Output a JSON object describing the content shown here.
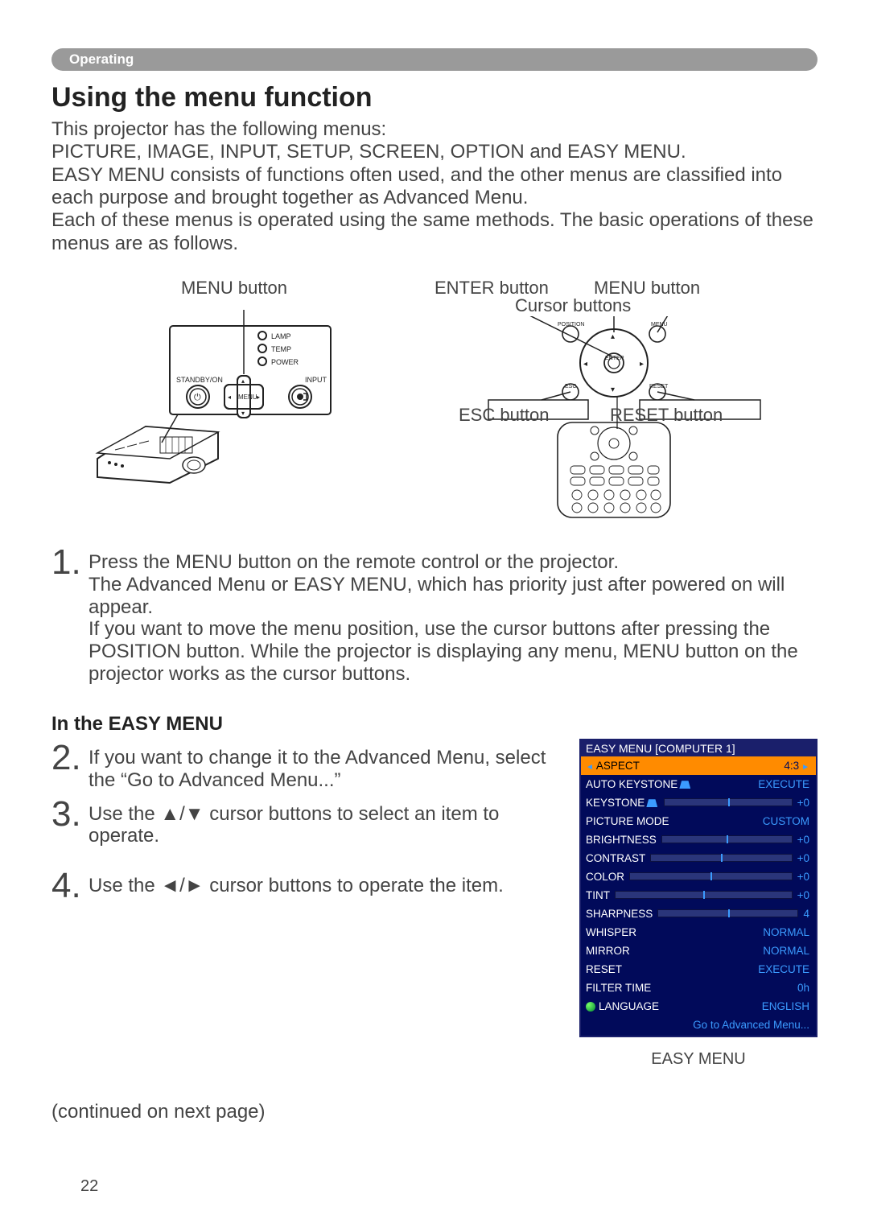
{
  "section_label": "Operating",
  "title": "Using the menu function",
  "intro": "This projector has the following menus:\nPICTURE, IMAGE, INPUT, SETUP, SCREEN, OPTION and EASY MENU.\nEASY MENU consists of functions often used, and the other menus are classified into each purpose and brought together as Advanced Menu.\nEach of these menus is operated using the same methods. The basic operations of these menus are as follows.",
  "diagram": {
    "projector": {
      "title": "MENU button",
      "labels": {
        "lamp": "LAMP",
        "temp": "TEMP",
        "power": "POWER",
        "standby": "STANDBY/ON",
        "input": "INPUT",
        "menu": "MENU"
      }
    },
    "remote": {
      "enter": "ENTER button",
      "menu": "MENU button",
      "cursor": "Cursor buttons",
      "esc": "ESC button",
      "reset": "RESET button",
      "small": {
        "position": "POSITION",
        "menu": "MENU",
        "enter": "ENTER",
        "esc": "ESC",
        "reset": "RESET"
      }
    }
  },
  "step1": {
    "num": "1.",
    "text": "Press the MENU button on the remote control or the projector.\nThe Advanced Menu or EASY MENU, which has priority just after powered on will appear.\nIf you want to move the menu position, use the cursor buttons after pressing the POSITION button. While the projector is displaying any menu, MENU button on the projector works as the cursor buttons."
  },
  "easy_heading": "In the EASY MENU",
  "step2": {
    "num": "2.",
    "text": "If you want to change it to the Advanced Menu, select the “Go to Advanced Menu...”"
  },
  "step3": {
    "num": "3.",
    "text": "Use the ▲/▼ cursor buttons to select an item to operate."
  },
  "step4": {
    "num": "4.",
    "text": "Use the ◄/► cursor buttons to operate the item."
  },
  "easy_menu": {
    "title": "EASY MENU [COMPUTER 1]",
    "rows": [
      {
        "l": "ASPECT",
        "v": "4:3",
        "sel": true,
        "arrows": true
      },
      {
        "l": "AUTO KEYSTONE",
        "v": "EXECUTE",
        "keyst": true
      },
      {
        "l": "KEYSTONE",
        "v": "+0",
        "bar": true,
        "keyst": true
      },
      {
        "l": "PICTURE MODE",
        "v": "CUSTOM"
      },
      {
        "l": "BRIGHTNESS",
        "v": "+0",
        "bar": true
      },
      {
        "l": "CONTRAST",
        "v": "+0",
        "bar": true
      },
      {
        "l": "COLOR",
        "v": "+0",
        "bar": true
      },
      {
        "l": "TINT",
        "v": "+0",
        "bar": true
      },
      {
        "l": "SHARPNESS",
        "v": "4",
        "bar": true
      },
      {
        "l": "WHISPER",
        "v": "NORMAL"
      },
      {
        "l": "MIRROR",
        "v": "NORMAL"
      },
      {
        "l": "RESET",
        "v": "EXECUTE"
      },
      {
        "l": "FILTER TIME",
        "v": "0h"
      },
      {
        "l": "LANGUAGE",
        "v": "ENGLISH",
        "globe": true
      }
    ],
    "footer": "Go to Advanced Menu...",
    "caption": "EASY MENU"
  },
  "continued": "(continued on next page)",
  "page": "22"
}
